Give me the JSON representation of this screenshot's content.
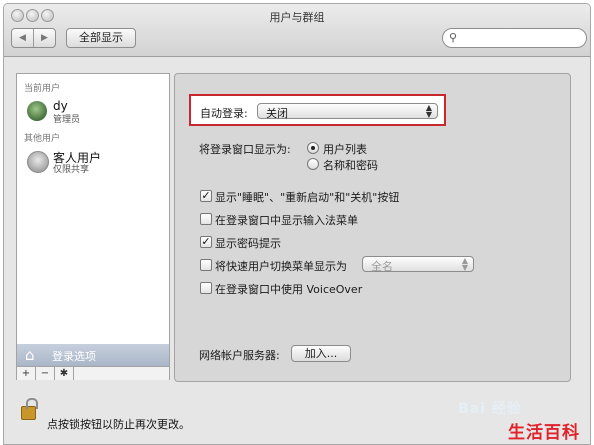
{
  "window": {
    "title": "用户与群组",
    "nav_back": "◀",
    "nav_forward": "▶",
    "show_all": "全部显示",
    "search_placeholder": ""
  },
  "sidebar": {
    "current_users_header": "当前用户",
    "current_user": {
      "name": "dy",
      "role": "管理员"
    },
    "other_users_header": "其他用户",
    "guest_user": {
      "name": "客人用户",
      "role": "仅限共享"
    },
    "login_options_label": "登录选项",
    "add_button": "+",
    "remove_button": "−",
    "gear_button": "✱"
  },
  "panel": {
    "auto_login_label": "自动登录:",
    "auto_login_value": "关闭",
    "display_window_label": "将登录窗口显示为:",
    "radio_options": [
      {
        "label": "用户列表",
        "selected": true
      },
      {
        "label": "名称和密码",
        "selected": false
      }
    ],
    "checkboxes": [
      {
        "label": "显示\"睡眠\"、\"重新启动\"和\"关机\"按钮",
        "checked": true
      },
      {
        "label": "在登录窗口中显示输入法菜单",
        "checked": false
      },
      {
        "label": "显示密码提示",
        "checked": true
      },
      {
        "label": "将快速用户切换菜单显示为",
        "checked": false
      },
      {
        "label": "在登录窗口中使用 VoiceOver",
        "checked": false
      }
    ],
    "fast_switch_value": "全名",
    "network_server_label": "网络帐户服务器:",
    "join_button": "加入..."
  },
  "footer": {
    "lock_text": "点按锁按钮以防止再次更改。"
  },
  "watermark": {
    "baidu": "Bai 经验",
    "brand": "生活百科"
  },
  "colors": {
    "highlight_border": "#c8282d",
    "sidebar_selection": "#aab6c8",
    "brand_red": "#e0232a"
  }
}
